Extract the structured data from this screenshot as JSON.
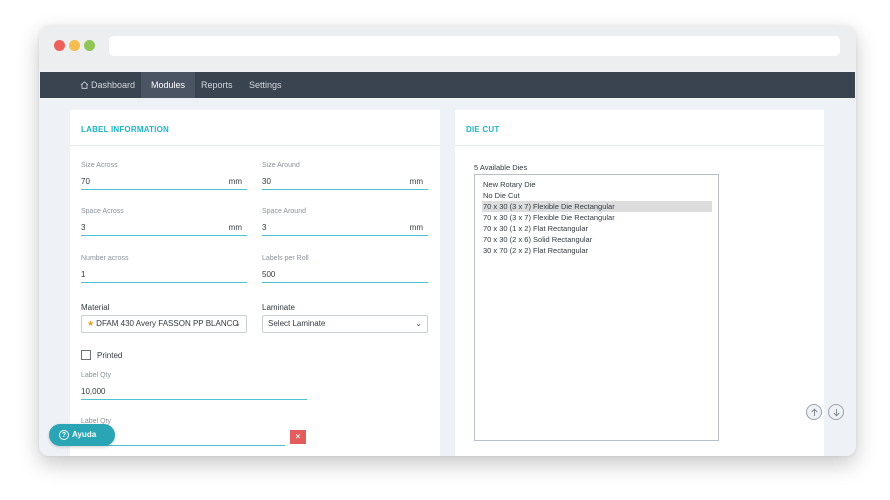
{
  "nav": {
    "items": [
      {
        "label": "Dashboard",
        "icon": "home-icon"
      },
      {
        "label": "Modules"
      },
      {
        "label": "Reports"
      },
      {
        "label": "Settings"
      }
    ],
    "active": "Modules"
  },
  "label_info": {
    "title": "LABEL INFORMATION",
    "size_across": {
      "label": "Size Across",
      "value": "70",
      "unit": "mm"
    },
    "size_around": {
      "label": "Size Around",
      "value": "30",
      "unit": "mm"
    },
    "space_across": {
      "label": "Space Across",
      "value": "3",
      "unit": "mm"
    },
    "space_around": {
      "label": "Space Around",
      "value": "3",
      "unit": "mm"
    },
    "number_across": {
      "label": "Number across",
      "value": "1"
    },
    "labels_per_roll": {
      "label": "Labels per Roll",
      "value": "500"
    },
    "material": {
      "label": "Material",
      "value": "DFAM 430 Avery FASSON PP BLANCO"
    },
    "laminate": {
      "label": "Laminate",
      "value": "Select Laminate"
    },
    "printed": {
      "label": "Printed",
      "checked": false
    },
    "label_qty": {
      "label": "Label Qty",
      "value": "10,000"
    },
    "label_qty_2": {
      "label": "Label Qty",
      "value": ""
    }
  },
  "die_cut": {
    "title": "DIE CUT",
    "count_label": "5 Available Dies",
    "options": [
      "New Rotary Die",
      "No Die Cut",
      "70 x 30 (3 x 7) Flexible Die Rectangular",
      "70 x 30 (3 x 7) Flexible Die Rectangular",
      "70 x 30 (1 x 2) Flat Rectangular",
      "70 x 30 (2 x 6) Solid Rectangular",
      "30 x 70 (2 x 2) Flat Rectangular"
    ],
    "selected_index": 2
  },
  "help": {
    "label": "Ayuda"
  },
  "delete": {
    "label": "×"
  },
  "colors": {
    "accent": "#1fb5c7",
    "nav_bg": "#3a4350",
    "danger": "#e35d5d"
  }
}
